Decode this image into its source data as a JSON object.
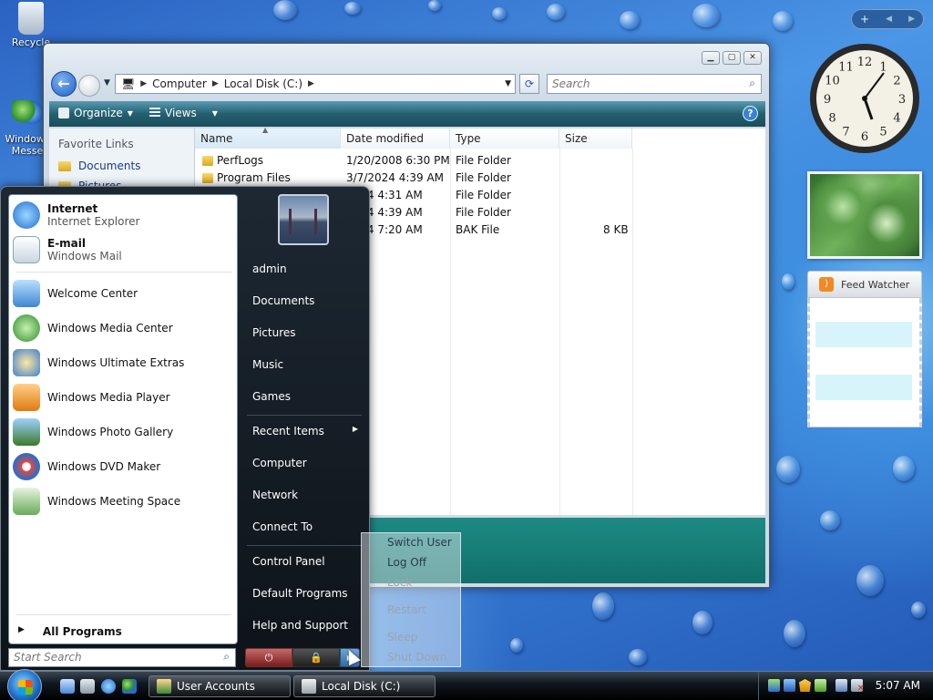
{
  "desktop": {
    "icons": [
      {
        "label": "Recycle"
      },
      {
        "label": "Windows Messe"
      }
    ]
  },
  "explorer": {
    "address": {
      "root": "Computer",
      "drive": "Local Disk (C:)"
    },
    "search_placeholder": "Search",
    "toolbar": {
      "organize": "Organize",
      "views": "Views"
    },
    "favorite_links": {
      "header": "Favorite Links",
      "items": [
        "Documents",
        "Pictures"
      ]
    },
    "columns": [
      "Name",
      "Date modified",
      "Type",
      "Size"
    ],
    "files": [
      {
        "name": "PerfLogs",
        "date": "1/20/2008 6:30 PM",
        "type": "File Folder",
        "size": ""
      },
      {
        "name": "Program Files",
        "date": "3/7/2024 4:39 AM",
        "type": "File Folder",
        "size": ""
      },
      {
        "name": "",
        "date": "2024 4:31 AM",
        "type": "File Folder",
        "size": ""
      },
      {
        "name": "",
        "date": "2024 4:39 AM",
        "type": "File Folder",
        "size": ""
      },
      {
        "name": "",
        "date": "2024 7:20 AM",
        "type": "BAK File",
        "size": "8 KB"
      }
    ]
  },
  "gadgets": {
    "feed_title": "Feed Watcher",
    "clock_numbers": [
      "12",
      "1",
      "2",
      "3",
      "4",
      "5",
      "6",
      "7",
      "8",
      "9",
      "10",
      "11"
    ]
  },
  "start_menu": {
    "pinned": [
      {
        "title": "Internet",
        "subtitle": "Internet Explorer"
      },
      {
        "title": "E-mail",
        "subtitle": "Windows Mail"
      }
    ],
    "recent": [
      "Welcome Center",
      "Windows Media Center",
      "Windows Ultimate Extras",
      "Windows Media Player",
      "Windows Photo Gallery",
      "Windows DVD Maker",
      "Windows Meeting Space"
    ],
    "all_programs": "All Programs",
    "search_placeholder": "Start Search",
    "right": {
      "user": "admin",
      "items": [
        "Documents",
        "Pictures",
        "Music",
        "Games"
      ],
      "items2": [
        "Recent Items",
        "Computer",
        "Network",
        "Connect To"
      ],
      "items3": [
        "Control Panel",
        "Default Programs",
        "Help and Support"
      ]
    },
    "power_submenu": {
      "switch_user": "Switch User",
      "log_off": "Log Off",
      "lock": "Lock",
      "restart": "Restart",
      "sleep": "Sleep",
      "shut_down": "Shut Down"
    }
  },
  "taskbar": {
    "buttons": [
      "User Accounts",
      "Local Disk (C:)"
    ],
    "time": "5:07 AM"
  }
}
